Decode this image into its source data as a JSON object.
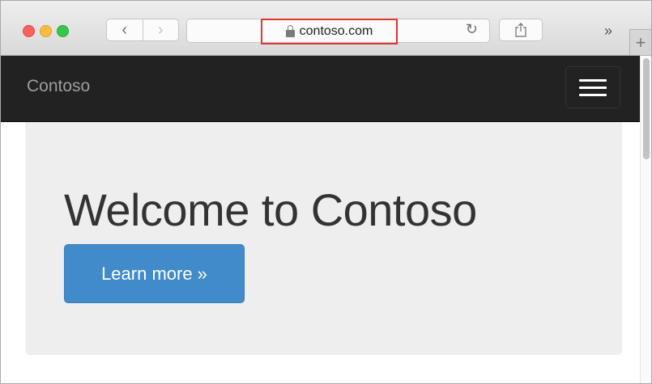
{
  "browser": {
    "url": "contoso.com",
    "back_glyph": "‹",
    "forward_glyph": "›",
    "reload_glyph": "↻",
    "more_glyph": "»",
    "new_tab_glyph": "+",
    "highlight_color": "#e0362e"
  },
  "navbar": {
    "brand": "Contoso",
    "background": "#222222"
  },
  "hero": {
    "heading": "Welcome to Contoso",
    "button_label": "Learn more »",
    "button_color": "#428bca"
  }
}
